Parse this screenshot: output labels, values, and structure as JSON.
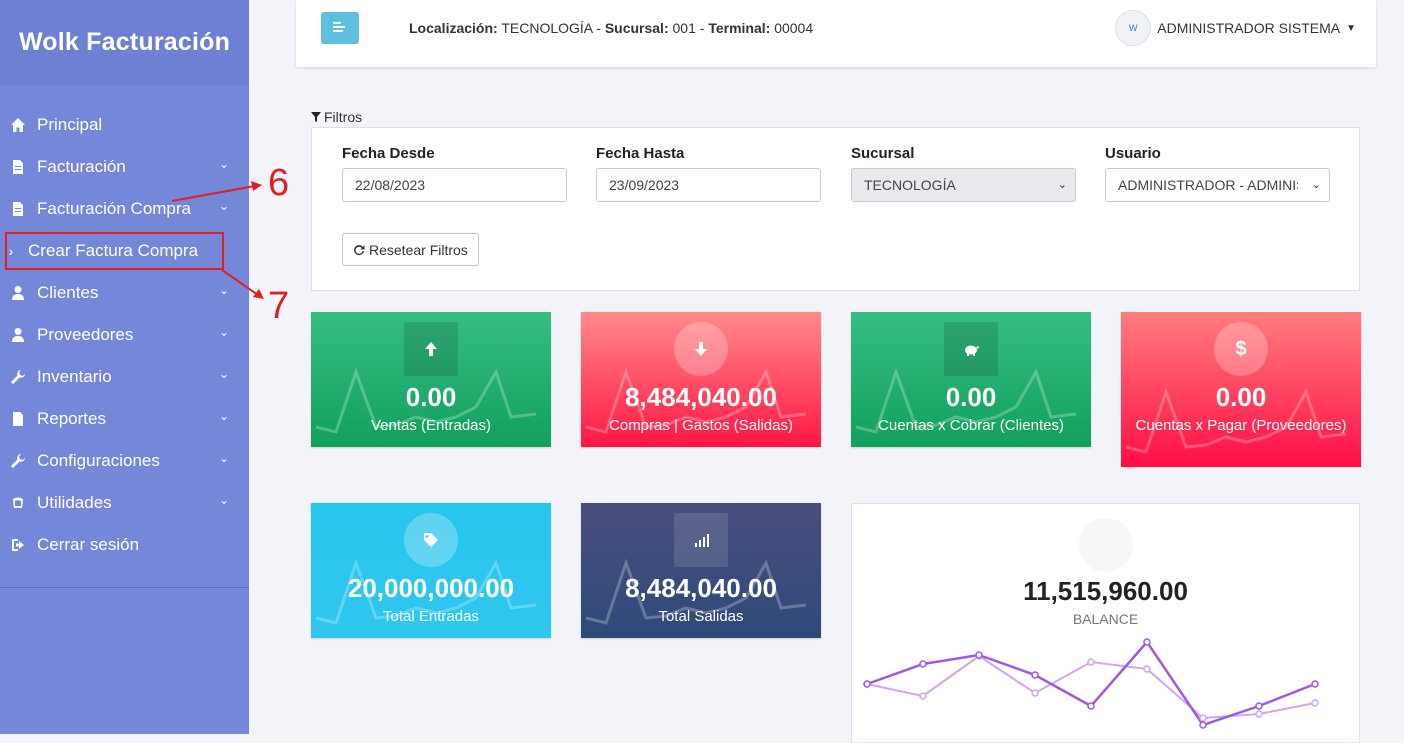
{
  "app": {
    "brand": "Wolk Facturación"
  },
  "sidebar": {
    "items": [
      {
        "label": "Principal",
        "icon": "home-icon"
      },
      {
        "label": "Facturación",
        "icon": "file-icon"
      },
      {
        "label": "Facturación Compra",
        "icon": "file-icon"
      },
      {
        "label": "Crear Factura Compra",
        "icon": "chevron-right-icon"
      },
      {
        "label": "Clientes",
        "icon": "user-icon"
      },
      {
        "label": "Proveedores",
        "icon": "user-icon"
      },
      {
        "label": "Inventario",
        "icon": "wrench-icon"
      },
      {
        "label": "Reportes",
        "icon": "file-icon"
      },
      {
        "label": "Configuraciones",
        "icon": "wrench-icon"
      },
      {
        "label": "Utilidades",
        "icon": "cloud-icon"
      },
      {
        "label": "Cerrar sesión",
        "icon": "logout-icon"
      }
    ]
  },
  "header": {
    "loc_label": "Localización:",
    "loc_value": "TECNOLOGÍA",
    "suc_label": "Sucursal:",
    "suc_value": "001",
    "term_label": "Terminal:",
    "term_value": "00004",
    "sep": "-",
    "user_name": "ADMINISTRADOR SISTEMA",
    "avatar_text": "W"
  },
  "filters": {
    "title": "Filtros",
    "fecha_desde_label": "Fecha Desde",
    "fecha_desde_value": "22/08/2023",
    "fecha_hasta_label": "Fecha Hasta",
    "fecha_hasta_value": "23/09/2023",
    "sucursal_label": "Sucursal",
    "sucursal_value": "TECNOLOGÍA",
    "usuario_label": "Usuario",
    "usuario_value": "ADMINISTRADOR - ADMINIS",
    "reset_label": "Resetear Filtros"
  },
  "stats": [
    {
      "value": "0.00",
      "label": "Ventas (Entradas)",
      "icon": "arrow-up-icon"
    },
    {
      "value": "8,484,040.00",
      "label": "Compras | Gastos (Salidas)",
      "icon": "arrow-down-icon"
    },
    {
      "value": "0.00",
      "label": "Cuentas x Cobrar (Clientes)",
      "icon": "piggy-bank-icon"
    },
    {
      "value": "0.00",
      "label": "Cuentas x Pagar (Proveedores)",
      "icon": "dollar-icon"
    },
    {
      "value": "20,000,000.00",
      "label": "Total Entradas",
      "icon": "tags-icon"
    },
    {
      "value": "8,484,040.00",
      "label": "Total Salidas",
      "icon": "signal-icon"
    }
  ],
  "balance": {
    "value": "11,515,960.00",
    "label": "BALANCE"
  },
  "annotations": {
    "six": "6",
    "seven": "7"
  },
  "colors": {
    "sidebar": "#7487d8",
    "accent_red": "#e02020",
    "balance_line": "#9b59e6"
  }
}
